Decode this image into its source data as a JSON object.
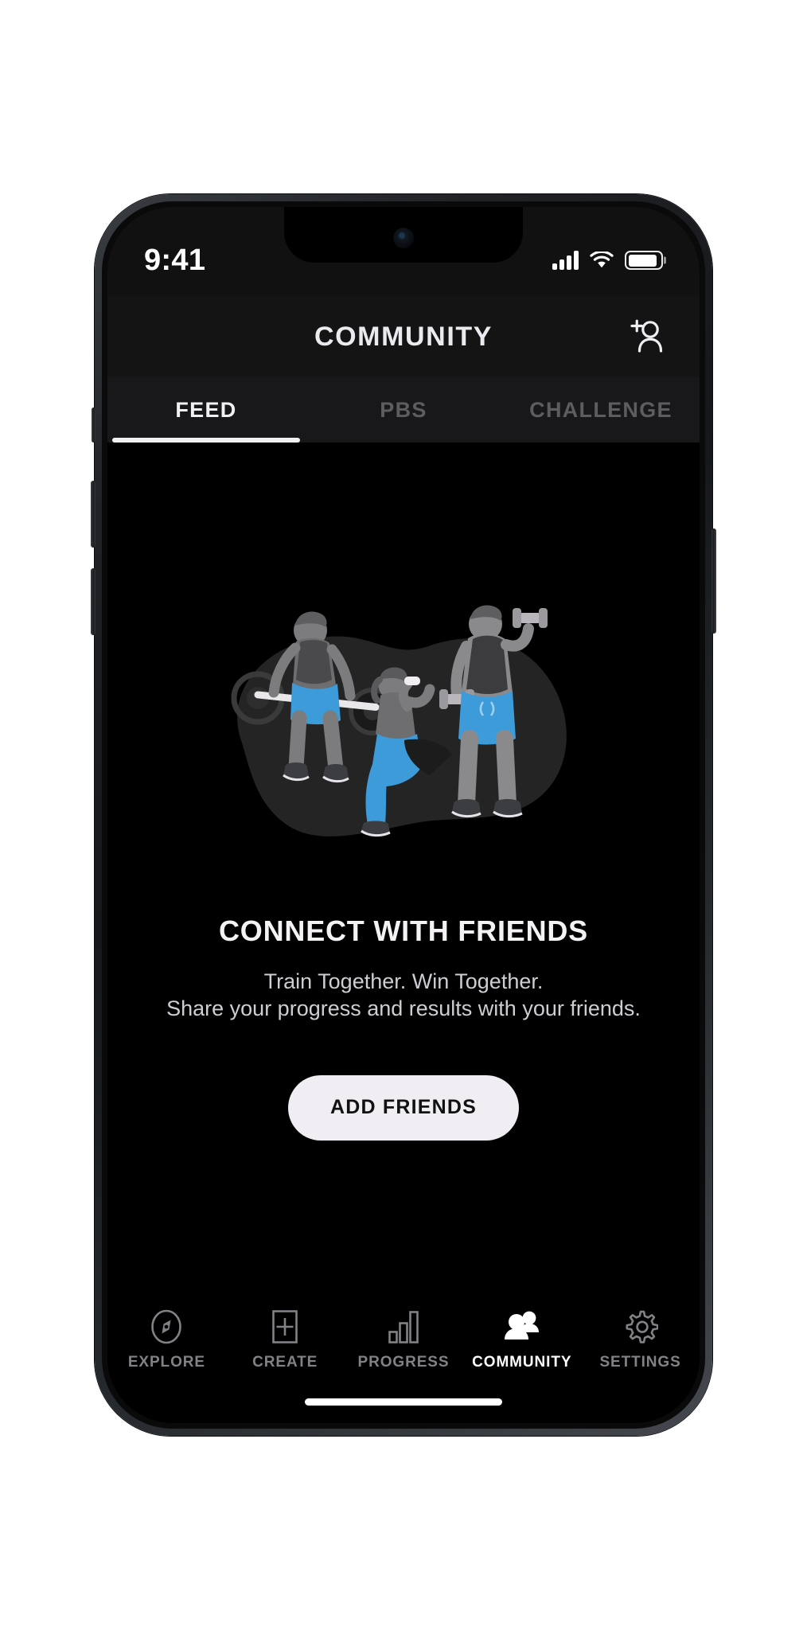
{
  "status_bar": {
    "time": "9:41",
    "signal_icon": "cellular-signal-icon",
    "wifi_icon": "wifi-icon",
    "battery_icon": "battery-icon",
    "battery_level": 92
  },
  "header": {
    "title": "COMMUNITY",
    "action_icon": "add-person-icon"
  },
  "tabs": {
    "active_index": 0,
    "items": [
      {
        "label": "FEED"
      },
      {
        "label": "PBS"
      },
      {
        "label": "CHALLENGE"
      }
    ]
  },
  "empty_state": {
    "illustration": "three-people-lifting-weights-illustration",
    "title": "CONNECT WITH FRIENDS",
    "subtitle_line1": "Train Together. Win Together.",
    "subtitle_line2": "Share your progress and results with your friends.",
    "cta_label": "ADD FRIENDS"
  },
  "bottom_nav": {
    "active_index": 3,
    "items": [
      {
        "label": "EXPLORE",
        "icon": "compass-icon"
      },
      {
        "label": "CREATE",
        "icon": "plus-square-icon"
      },
      {
        "label": "PROGRESS",
        "icon": "bar-chart-icon"
      },
      {
        "label": "COMMUNITY",
        "icon": "people-icon"
      },
      {
        "label": "SETTINGS",
        "icon": "gear-icon"
      }
    ]
  },
  "colors": {
    "background": "#000000",
    "header_bg": "#141415",
    "tabs_bg": "#18181a",
    "accent_blue": "#3d9bd9",
    "text_primary": "#f2f0f3",
    "text_muted": "#828286",
    "cta_bg": "#f1eef3"
  }
}
